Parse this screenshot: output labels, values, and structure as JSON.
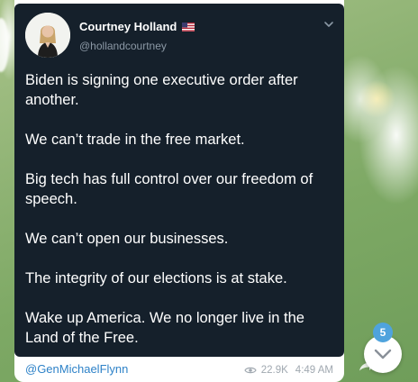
{
  "tweet": {
    "display_name": "Courtney Holland",
    "handle": "@hollandcourtney",
    "flag_icon": "us-flag-icon",
    "paragraphs": [
      "Biden is signing one executive order after another.",
      "We can’t trade in the free market.",
      "Big tech has full control over our freedom of speech.",
      "We can’t open our businesses.",
      "The integrity of our elections is at stake.",
      "Wake up America. We no longer live in the Land of the Free."
    ],
    "background_color": "#15202b"
  },
  "message": {
    "signature": "@GenMichaelFlynn",
    "views": "22.9K",
    "time": "4:49 AM",
    "view_icon": "eye-icon",
    "share_icon": "share-arrow-icon"
  },
  "scroll_down": {
    "icon": "chevron-down-icon",
    "unread_count": "5",
    "badge_color": "#4fa3dd"
  }
}
